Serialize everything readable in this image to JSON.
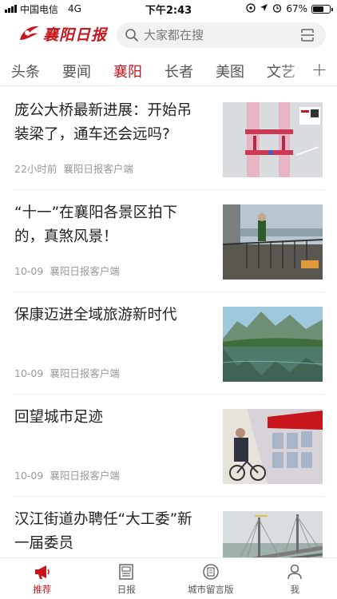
{
  "status_bar": {
    "carrier": "中国电信",
    "network": "4G",
    "time": "下午2:43",
    "battery_percent": "67%",
    "battery_level": 0.67
  },
  "header": {
    "logo_text": "襄阳日报",
    "search_placeholder": "大家都在搜",
    "accent_color": "#c8161d"
  },
  "tabs": [
    {
      "label": "头条"
    },
    {
      "label": "要闻"
    },
    {
      "label": "襄阳",
      "active": true
    },
    {
      "label": "长者"
    },
    {
      "label": "美图"
    },
    {
      "label": "文艺"
    }
  ],
  "tab_plus": "+",
  "news": [
    {
      "title": "庞公大桥最新进展：开始吊装梁了，通车还会远吗?",
      "time": "22小时前",
      "source": "襄阳日报客户端",
      "image": "bridge-construction"
    },
    {
      "title": "“十一”在襄阳各景区拍下的，真煞风景！",
      "time": "10-09",
      "source": "襄阳日报客户端",
      "image": "scenic-railing"
    },
    {
      "title": "保康迈进全域旅游新时代",
      "time": "10-09",
      "source": "襄阳日报客户端",
      "image": "mountain-lake"
    },
    {
      "title": "回望城市足迹",
      "time": "10-09",
      "source": "襄阳日报客户端",
      "image": "exhibition-boards"
    },
    {
      "title": "汉江街道办聘任“大工委”新一届委员",
      "time": "",
      "source": "",
      "image": "cable-bridge"
    }
  ],
  "bottom_nav": [
    {
      "label": "推荐",
      "icon": "megaphone-icon",
      "active": true
    },
    {
      "label": "日报",
      "icon": "newspaper-icon"
    },
    {
      "label": "城市留言版",
      "icon": "message-board-icon"
    },
    {
      "label": "我",
      "icon": "person-icon"
    }
  ]
}
